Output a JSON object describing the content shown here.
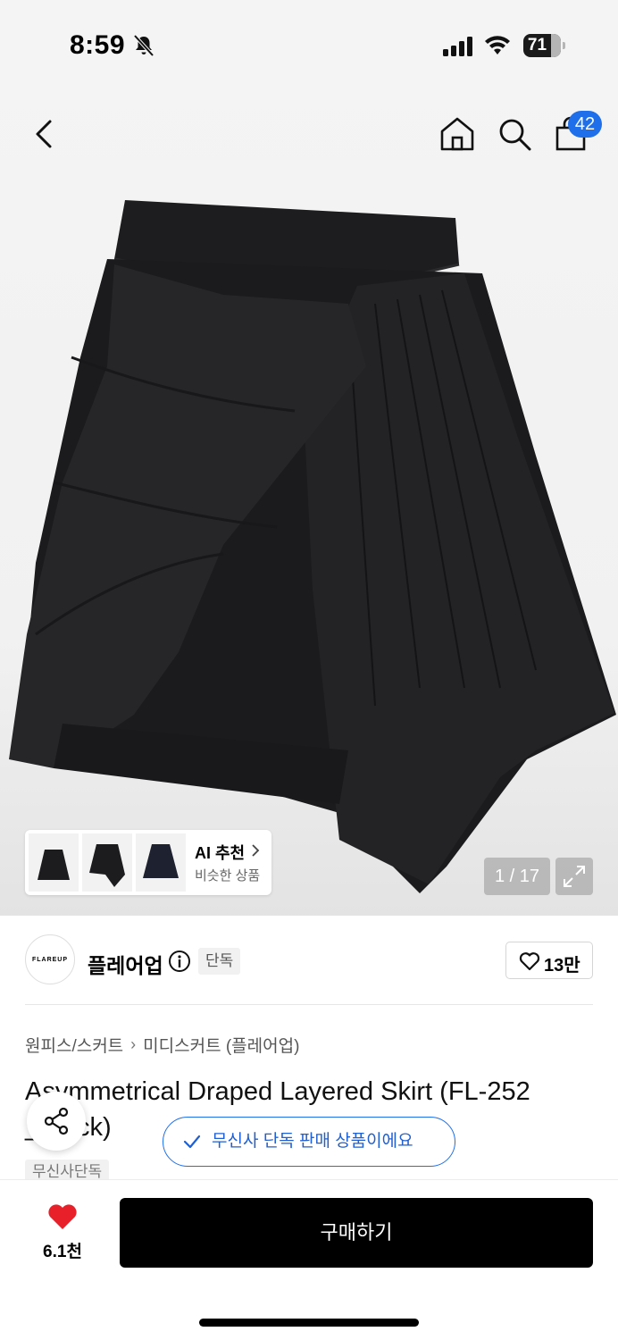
{
  "status_bar": {
    "time": "8:59",
    "battery": "71",
    "icons": [
      "bell-slash-icon",
      "cellular-signal-icon",
      "wifi-icon",
      "battery-icon"
    ]
  },
  "nav": {
    "cart_badge": "42",
    "icons": [
      "chevron-left-icon",
      "home-icon",
      "search-icon",
      "shopping-bag-icon"
    ]
  },
  "gallery": {
    "page_indicator": "1 / 17",
    "ai_card": {
      "title": "AI 추천",
      "subtitle": "비슷한 상품"
    }
  },
  "brand": {
    "logo_text": "FLAREUP",
    "name": "플레어업",
    "exclusive_tag": "단독",
    "like_count": "13만"
  },
  "product": {
    "breadcrumb": [
      "원피스/스커트",
      "미디스커트 (플레어업)"
    ],
    "title_line1": "Asymmetrical Draped Layered Skirt (FL-252",
    "title_line2": "_Black)",
    "tag": "무신사단독"
  },
  "toast": {
    "text": "무신사 단독 판매 상품이에요"
  },
  "bottom_bar": {
    "wish_count": "6.1천",
    "buy_label": "구매하기"
  },
  "colors": {
    "accent_blue": "#1f6feb",
    "wish_red": "#e8202a",
    "buy_button": "#000000"
  }
}
